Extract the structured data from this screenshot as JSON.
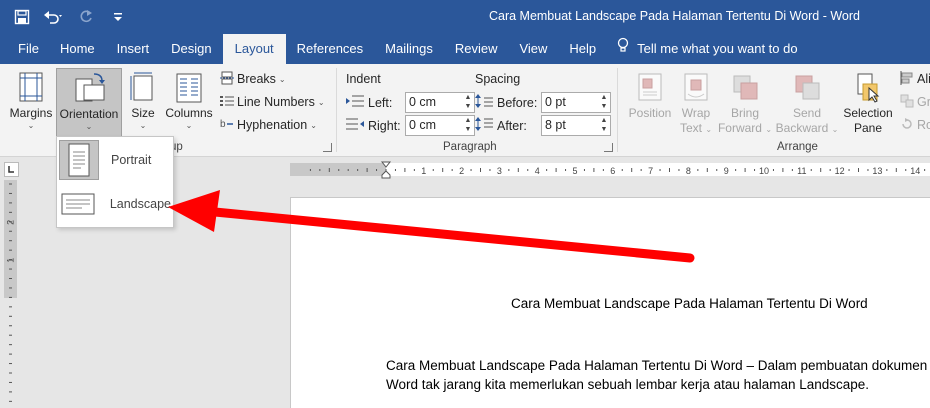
{
  "window": {
    "title": "Cara Membuat Landscape Pada Halaman Tertentu Di Word  -  Word"
  },
  "quick_access": {
    "save_icon": "save-icon",
    "undo_icon": "undo-icon",
    "redo_icon": "redo-icon",
    "customize_icon": "customize-qat-icon"
  },
  "tabs": [
    {
      "label": "File"
    },
    {
      "label": "Home"
    },
    {
      "label": "Insert"
    },
    {
      "label": "Design"
    },
    {
      "label": "Layout",
      "active": true
    },
    {
      "label": "References"
    },
    {
      "label": "Mailings"
    },
    {
      "label": "Review"
    },
    {
      "label": "View"
    },
    {
      "label": "Help"
    }
  ],
  "tell_me": {
    "text": "Tell me what you want to do",
    "icon": "lightbulb-icon"
  },
  "page_setup": {
    "group_label": "Page Setup",
    "group_label_visible": "up",
    "margins": "Margins",
    "orientation": "Orientation",
    "size": "Size",
    "columns": "Columns",
    "breaks": "Breaks",
    "line_numbers": "Line Numbers",
    "hyphenation": "Hyphenation"
  },
  "paragraph": {
    "group_label": "Paragraph",
    "indent_label": "Indent",
    "spacing_label": "Spacing",
    "left_label": "Left:",
    "left_value": "0 cm",
    "right_label": "Right:",
    "right_value": "0 cm",
    "before_label": "Before:",
    "before_value": "0 pt",
    "after_label": "After:",
    "after_value": "8 pt"
  },
  "arrange": {
    "group_label": "Arrange",
    "position": "Position",
    "wrap_text_1": "Wrap",
    "wrap_text_2": "Text",
    "bring_forward_1": "Bring",
    "bring_forward_2": "Forward",
    "send_backward_1": "Send",
    "send_backward_2": "Backward",
    "selection_pane_1": "Selection",
    "selection_pane_2": "Pane",
    "align_partial": "Ali",
    "group_partial": "Gr",
    "rotate_partial": "Ro"
  },
  "orientation_menu": {
    "items": [
      {
        "label": "Portrait",
        "icon": "portrait-page-icon",
        "selected": true
      },
      {
        "label": "Landscape",
        "icon": "landscape-page-icon",
        "selected": false
      }
    ]
  },
  "ruler": {
    "h_labels": [
      "1",
      "2",
      "3",
      "4",
      "5",
      "6",
      "7",
      "8",
      "9",
      "10",
      "11",
      "12",
      "13",
      "14"
    ],
    "v_labels": [
      "2",
      "1"
    ]
  },
  "document": {
    "heading": "Cara Membuat Landscape Pada Halaman Tertentu Di Word",
    "paragraph_line1": "Cara Membuat Landscape Pada Halaman Tertentu Di Word – Dalam pembuatan dokumen di",
    "paragraph_line2": "Word tak jarang kita memerlukan sebuah lembar kerja atau halaman Landscape."
  },
  "colors": {
    "titlebar": "#2b579a",
    "ribbon": "#f3f3f3",
    "annotation_arrow": "#ff0000"
  }
}
